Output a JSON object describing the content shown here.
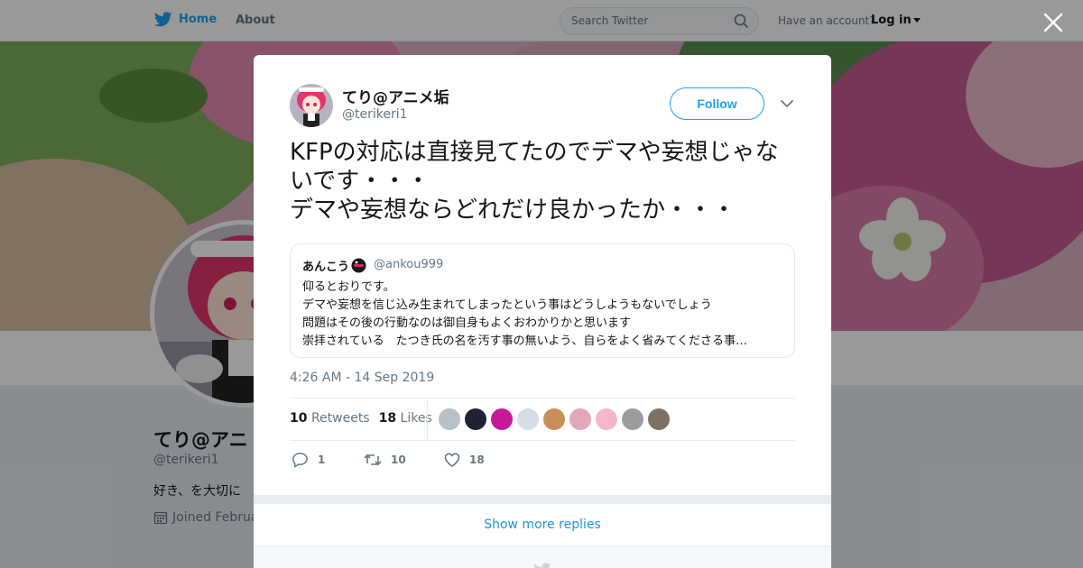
{
  "nav": {
    "home_label": "Home",
    "about_label": "About",
    "search_placeholder": "Search Twitter",
    "have_account": "Have an account?",
    "login_label": "Log in"
  },
  "profile": {
    "name": "てり@アニ",
    "handle": "@terikeri1",
    "bio": "好き、を大切に",
    "joined": "Joined Februa"
  },
  "tweet": {
    "author_name": "てり@アニメ垢",
    "author_handle": "@terikeri1",
    "follow_label": "Follow",
    "text": "KFPの対応は直接見てたのでデマや妄想じゃないです・・・\nデマや妄想ならどれだけ良かったか・・・",
    "quoted": {
      "name": "あんこう",
      "handle": "@ankou999",
      "lines": [
        "仰るとおりです。",
        "デマや妄想を信じ込み生まれてしまったという事はどうしようもないでしょう",
        "問題はその後の行動なのは御自身もよくおわかりかと思います",
        "崇拝されている　たつき氏の名を汚す事の無いよう、自らをよく省みてくださる事…"
      ]
    },
    "timestamp": "4:26 AM - 14 Sep 2019",
    "retweets_count": "10",
    "retweets_label": "Retweets",
    "likes_count": "18",
    "likes_label": "Likes",
    "reply_count": "1",
    "retweet_action_count": "10",
    "like_action_count": "18"
  },
  "likers": [
    "#b8c0c8",
    "#1f2233",
    "#c7189a",
    "#d6dde6",
    "#c98f5a",
    "#e0a9b8",
    "#f3b6cc",
    "#9c9c9c",
    "#7d7166"
  ],
  "show_more_label": "Show more replies",
  "colors": {
    "accent": "#1da1f2",
    "text": "#14171a",
    "muted": "#657786",
    "border": "#e6ecf0"
  },
  "icons": [
    "twitter-bird-icon",
    "search-icon",
    "close-icon",
    "chevron-down-icon",
    "reply-icon",
    "retweet-icon",
    "like-icon",
    "calendar-icon"
  ]
}
